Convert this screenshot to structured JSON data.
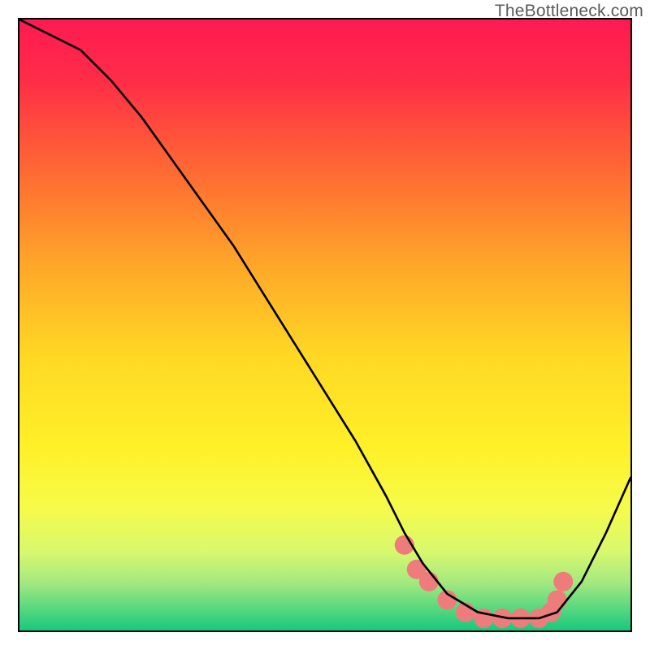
{
  "watermark": "TheBottleneck.com",
  "chart_data": {
    "type": "line",
    "title": "",
    "xlabel": "",
    "ylabel": "",
    "xlim": [
      0,
      100
    ],
    "ylim": [
      0,
      100
    ],
    "series": [
      {
        "name": "curve",
        "color": "#000000",
        "x": [
          0,
          4,
          10,
          15,
          20,
          25,
          30,
          35,
          40,
          45,
          50,
          55,
          60,
          63,
          66,
          70,
          75,
          80,
          85,
          88,
          92,
          96,
          100
        ],
        "y": [
          100,
          98,
          95,
          90,
          84,
          77,
          70,
          63,
          55,
          47,
          39,
          31,
          22,
          16,
          11,
          6,
          3,
          2,
          2,
          3,
          8,
          16,
          25
        ]
      }
    ],
    "markers": {
      "name": "dots",
      "color": "#ef7c7c",
      "radius_relative": 1.6,
      "x": [
        63,
        65,
        67,
        70,
        73,
        76,
        79,
        82,
        85,
        87,
        88,
        89
      ],
      "y": [
        14,
        10,
        8,
        5,
        3,
        2,
        2,
        2,
        2,
        3,
        5,
        8
      ]
    },
    "background_gradient": {
      "stops": [
        {
          "offset": 0.0,
          "color": "#ff1a52"
        },
        {
          "offset": 0.1,
          "color": "#ff2d47"
        },
        {
          "offset": 0.25,
          "color": "#ff6a33"
        },
        {
          "offset": 0.4,
          "color": "#ffa629"
        },
        {
          "offset": 0.55,
          "color": "#ffd824"
        },
        {
          "offset": 0.7,
          "color": "#fff028"
        },
        {
          "offset": 0.8,
          "color": "#f6fb4a"
        },
        {
          "offset": 0.87,
          "color": "#d9f86e"
        },
        {
          "offset": 0.92,
          "color": "#a6e97f"
        },
        {
          "offset": 0.96,
          "color": "#5fd97f"
        },
        {
          "offset": 1.0,
          "color": "#17c97e"
        }
      ]
    }
  }
}
